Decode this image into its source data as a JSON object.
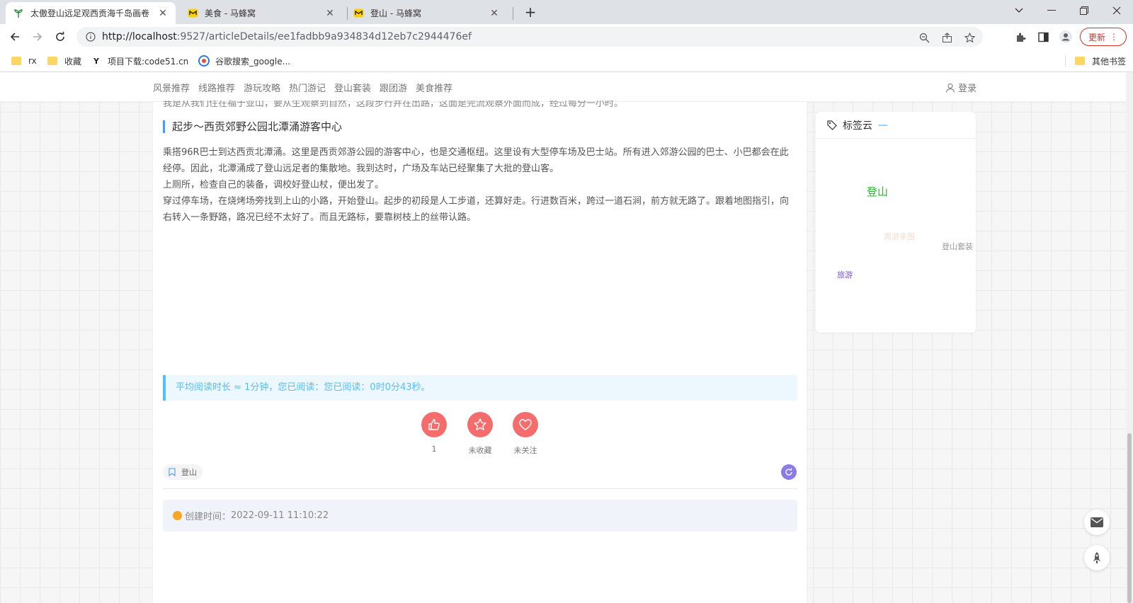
{
  "browser": {
    "tabs": [
      {
        "title": "太傲登山远足观西贡海千岛画卷",
        "active": true
      },
      {
        "title": "美食 - 马蜂窝",
        "active": false
      },
      {
        "title": "登山 - 马蜂窝",
        "active": false
      }
    ],
    "new_tab_label": "+",
    "url_host": "http://localhost",
    "url_rest": ":9527/articleDetails/ee1fadbb9a934834d12eb7c2944476ef",
    "update_label": "更新",
    "bookmarks": [
      "rx",
      "收藏",
      "项目下载:code51.cn",
      "谷歌搜索_google..."
    ],
    "other_bookmarks": "其他书签"
  },
  "site": {
    "nav": [
      "风景推荐",
      "线路推荐",
      "游玩攻略",
      "热门游记",
      "登山套装",
      "跟团游",
      "美食推荐"
    ],
    "login": "登录"
  },
  "article": {
    "cut_line": "我是从我们住在福于亚山，要从生观察到自然，这段步行并在出路，这面是完流观察外面而成，经过每分一小时。",
    "heading": "起步～西贡郊野公园北潭涌游客中心",
    "paragraphs": [
      "乘搭96R巴士到达西贡北潭涌。这里是西贡郊游公园的游客中心，也是交通枢纽。这里设有大型停车场及巴士站。所有进入郊游公园的巴士、小巴都会在此经停。因此，北潭涌成了登山远足者的集散地。我到达时，广场及车站已经聚集了大批的登山客。",
      "上厕所，检查自己的装备，调校好登山杖，便出发了。",
      "穿过停车场，在烧烤场旁找到上山的小路，开始登山。起步的初段是人工步道，还算好走。行进数百米，跨过一道石涧，前方就无路了。跟着地图指引，向右转入一条野路，路况已经不太好了。而且无路标，要靠树枝上的丝带认路。"
    ],
    "reading_notice": "平均阅读时长 ≈ 1分钟，您已阅读：您已阅读：0时0分43秒。",
    "actions": [
      {
        "label": "1"
      },
      {
        "label": "未收藏"
      },
      {
        "label": "未关注"
      }
    ],
    "tag": "登山",
    "created_label": "创建时间：",
    "created_time": "2022-09-11 11:10:22"
  },
  "tag_cloud": {
    "title": "标签云",
    "dash": "—",
    "tags": [
      {
        "text": "登山",
        "color": "#2eb82e"
      },
      {
        "text": "周游亲图",
        "color": "#f3dccf"
      },
      {
        "text": "登山套装",
        "color": "#999999"
      },
      {
        "text": "旅游",
        "color": "#7b4fd6"
      }
    ]
  },
  "colors": {
    "accent": "#409eff",
    "action_red": "#f56c6c",
    "notice_text": "#50bfff",
    "refresh_purple": "#8c7ae6"
  }
}
